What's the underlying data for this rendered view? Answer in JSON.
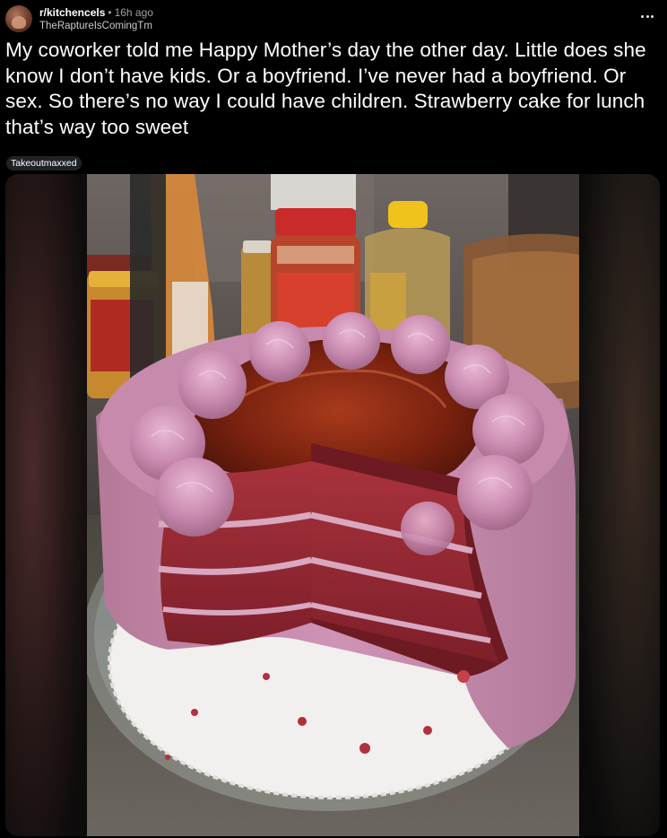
{
  "post": {
    "subreddit": "r/kitchencels",
    "separator": "•",
    "time_ago": "16h ago",
    "username": "TheRaptureIsComingTm",
    "title": "My coworker told me Happy Mother’s day the other day. Little does she know I don’t have kids. Or a boyfriend. I’ve never had a boyfriend. Or sex. So there’s no way I could have children. Strawberry cake for lunch that’s way too sweet",
    "flair": "Takeoutmaxxed"
  },
  "icons": {
    "more": "more-options-icon"
  },
  "colors": {
    "background": "#000000",
    "text_primary": "#ffffff",
    "text_secondary": "#9aa0a6",
    "flair_bg": "#1f2326",
    "cake_frosting": "#c98bb0",
    "cake_glaze": "#8a2a14",
    "cake_sponge": "#a8323c"
  }
}
